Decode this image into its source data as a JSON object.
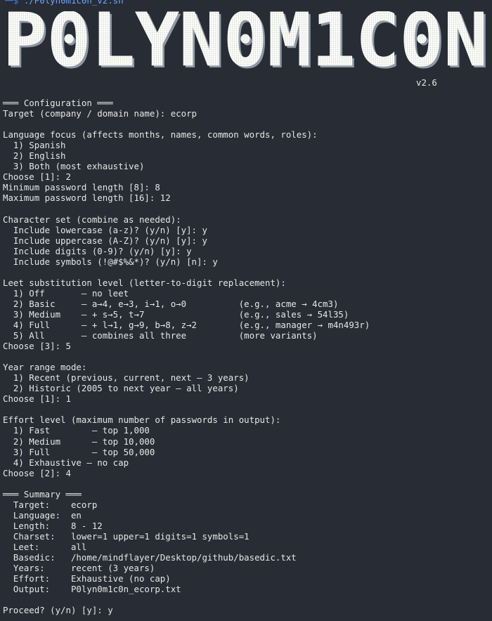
{
  "prompt": {
    "glyph": "└─$",
    "command": "./P0lyn0m1c0n_v2.sh"
  },
  "banner": {
    "text": "P0LYN0M1C0N",
    "fill_color": "#ffffff",
    "grid_color": "#cfd8c4",
    "shadow_color": "#9aa3ad"
  },
  "version": "v2.6",
  "lines": [
    "═══ Configuration ═══",
    "Target (company / domain name): ecorp",
    "",
    "Language focus (affects months, names, common words, roles):",
    "  1) Spanish",
    "  2) English",
    "  3) Both (most exhaustive)",
    "Choose [1]: 2",
    "Minimum password length [8]: 8",
    "Maximum password length [16]: 12",
    "",
    "Character set (combine as needed):",
    "  Include lowercase (a-z)? (y/n) [y]: y",
    "  Include uppercase (A-Z)? (y/n) [y]: y",
    "  Include digits (0-9)? (y/n) [y]: y",
    "  Include symbols (!@#$%&*)? (y/n) [n]: y",
    "",
    "Leet substitution level (letter-to-digit replacement):",
    "  1) Off       — no leet",
    "  2) Basic     — a→4, e→3, i→1, o→0          (e.g., acme → 4cm3)",
    "  3) Medium    — + s→5, t→7                  (e.g., sales → 54l35)",
    "  4) Full      — + l→1, g→9, b→8, z→2        (e.g., manager → m4n493r)",
    "  5) All       — combines all three          (more variants)",
    "Choose [3]: 5",
    "",
    "Year range mode:",
    "  1) Recent (previous, current, next — 3 years)",
    "  2) Historic (2005 to next year — all years)",
    "Choose [1]: 1",
    "",
    "Effort level (maximum number of passwords in output):",
    "  1) Fast        — top 1,000",
    "  2) Medium      — top 10,000",
    "  3) Full        — top 50,000",
    "  4) Exhaustive — no cap",
    "Choose [2]: 4",
    "",
    "═══ Summary ═══",
    "  Target:    ecorp",
    "  Language:  en",
    "  Length:    8 - 12",
    "  Charset:   lower=1 upper=1 digits=1 symbols=1",
    "  Leet:      all",
    "  Basedic:   /home/mindflayer/Desktop/github/basedic.txt",
    "  Years:     recent (3 years)",
    "  Effort:    Exhaustive (no cap)",
    "  Output:    P0lyn0m1c0n_ecorp.txt",
    "",
    "Proceed? (y/n) [y]: y"
  ]
}
